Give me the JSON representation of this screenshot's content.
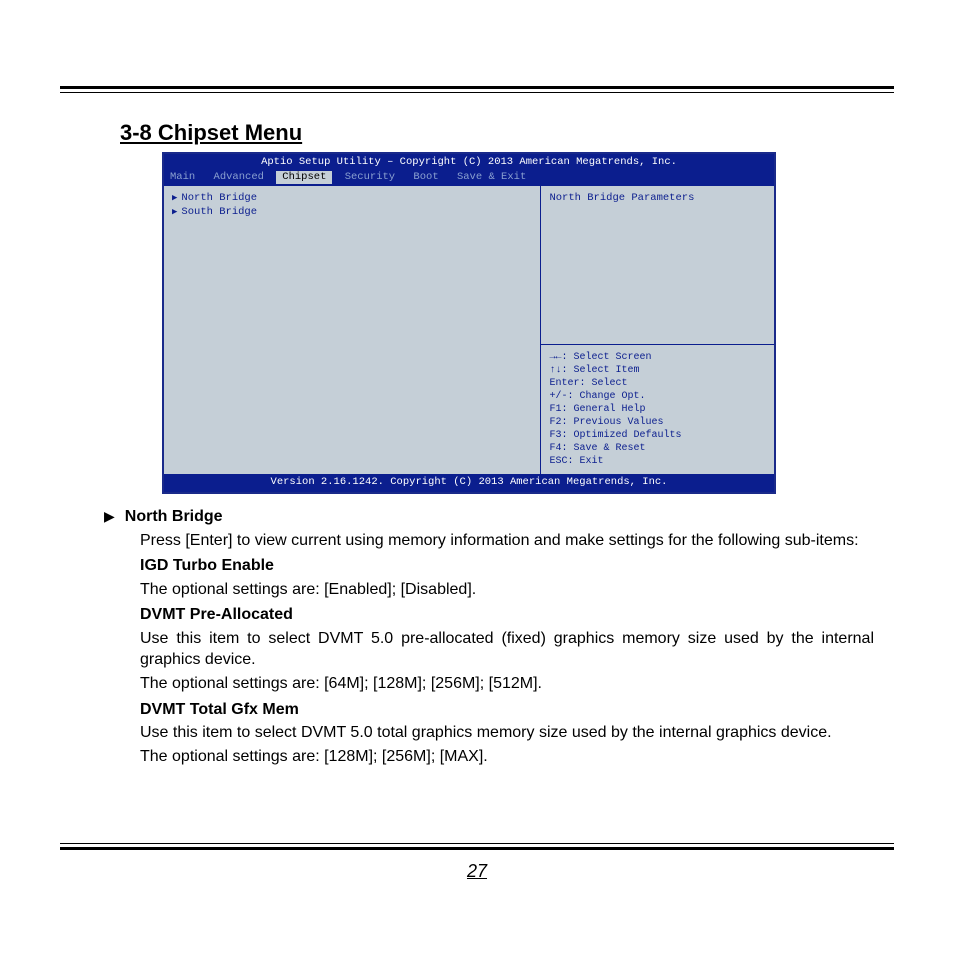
{
  "section_title": "3-8 Chipset Menu",
  "bios": {
    "title_bar": "Aptio Setup Utility – Copyright (C) 2013 American Megatrends, Inc.",
    "tabs": [
      "Main",
      "Advanced",
      "Chipset",
      "Security",
      "Boot",
      "Save & Exit"
    ],
    "active_tab_index": 2,
    "menu_items": [
      "North Bridge",
      "South Bridge"
    ],
    "help_title": "North Bridge Parameters",
    "help_keys": [
      "→←: Select Screen",
      "↑↓: Select Item",
      "Enter: Select",
      "+/-: Change Opt.",
      "F1: General Help",
      "F2: Previous Values",
      "F3: Optimized Defaults",
      "F4: Save & Reset",
      "ESC: Exit"
    ],
    "footer": "Version 2.16.1242. Copyright (C) 2013 American Megatrends, Inc."
  },
  "doc": {
    "bullet_title": "North Bridge",
    "intro": "Press [Enter] to view current using memory information and make settings for the following sub-items:",
    "sub1_head": "IGD Turbo Enable",
    "sub1_body": "The optional settings are: [Enabled]; [Disabled].",
    "sub2_head": "DVMT Pre-Allocated",
    "sub2_body1": "Use this item to select DVMT 5.0 pre-allocated (fixed) graphics memory size used by the internal graphics device.",
    "sub2_body2": "The optional settings are: [64M]; [128M]; [256M]; [512M].",
    "sub3_head": "DVMT Total Gfx Mem",
    "sub3_body1": "Use this item to select DVMT 5.0 total graphics memory size used by the internal graphics device.",
    "sub3_body2": "The optional settings are: [128M]; [256M]; [MAX]."
  },
  "page_number": "27"
}
